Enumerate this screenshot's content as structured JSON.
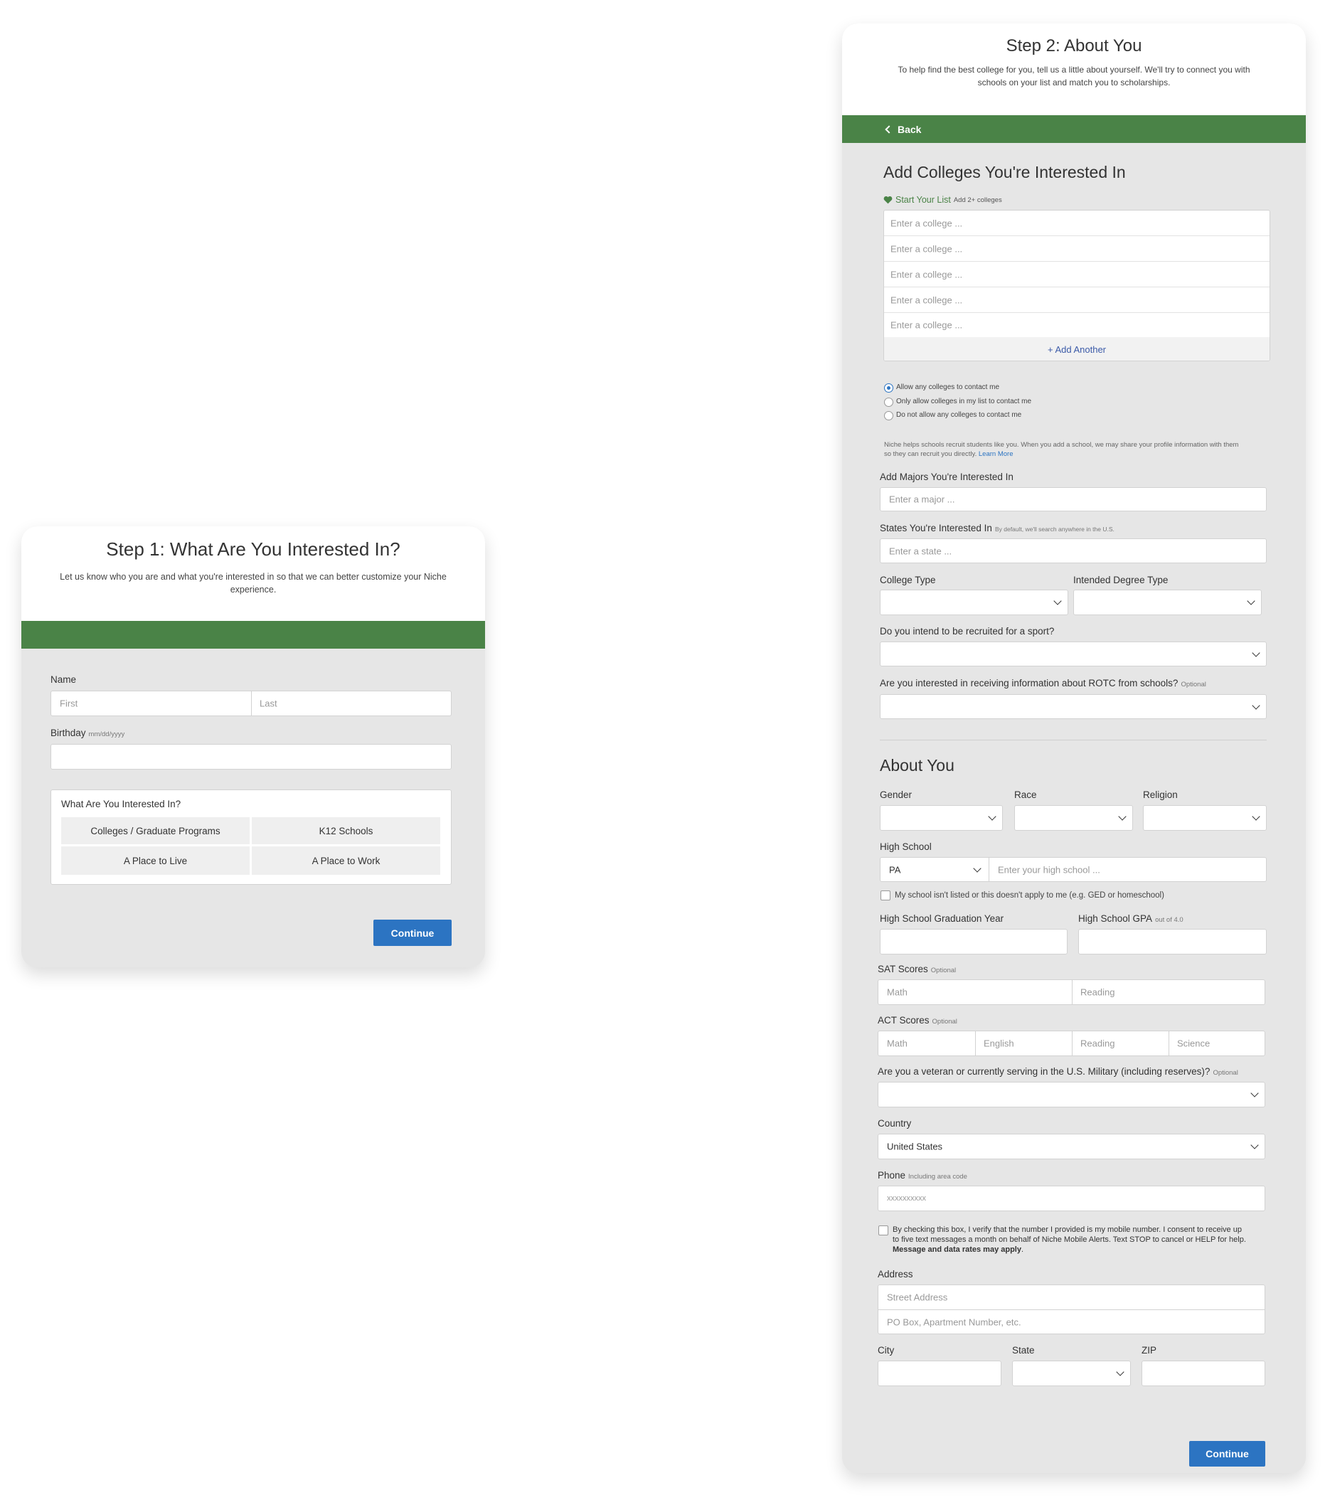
{
  "step1": {
    "title": "Step 1: What Are You Interested In?",
    "subtitle_line1": "Let us know who you are and what you're interested in so that we can better customize your Niche",
    "subtitle_line2": "experience.",
    "name_label": "Name",
    "first_placeholder": "First",
    "last_placeholder": "Last",
    "birthday_label": "Birthday",
    "birthday_hint": "mm/dd/yyyy",
    "interest_title": "What Are You Interested In?",
    "interests": [
      "Colleges / Graduate Programs",
      "K12 Schools",
      "A Place to Live",
      "A Place to Work"
    ],
    "continue": "Continue"
  },
  "step2": {
    "title": "Step 2: About You",
    "subtitle_line1": "To help find the best college for you, tell us a little about yourself. We'll try to connect you with",
    "subtitle_line2": "schools on your list and match you to scholarships.",
    "back": "Back",
    "colleges_heading": "Add Colleges You're Interested In",
    "start_list": "Start Your List",
    "start_list_hint": "Add 2+ colleges",
    "college_placeholder": "Enter a college ...",
    "add_another": "+ Add Another",
    "contact_options": [
      "Allow any colleges to contact me",
      "Only allow colleges in my list to contact me",
      "Do not allow any colleges to contact me"
    ],
    "recruit_note_line1": "Niche helps schools recruit students like you. When you add a school, we may share your profile information with them",
    "recruit_note_line2": "so they can recruit you directly.",
    "learn_more": "Learn More",
    "majors_label": "Add Majors You're Interested In",
    "major_placeholder": "Enter a major ...",
    "states_label": "States You're Interested In",
    "states_hint": "By default, we'll search anywhere in the U.S.",
    "state_placeholder": "Enter a state ...",
    "college_type_label": "College Type",
    "degree_type_label": "Intended Degree Type",
    "sport_label": "Do you intend to be recruited for a sport?",
    "rotc_label": "Are you interested in receiving information about ROTC from schools?",
    "optional": "Optional",
    "about_heading": "About You",
    "gender_label": "Gender",
    "race_label": "Race",
    "religion_label": "Religion",
    "high_school_label": "High School",
    "high_school_state": "PA",
    "high_school_placeholder": "Enter your high school ...",
    "not_listed": "My school isn't listed or this doesn't apply to me (e.g. GED or homeschool)",
    "grad_year_label": "High School Graduation Year",
    "gpa_label": "High School GPA",
    "gpa_hint": "out of 4.0",
    "sat_label": "SAT Scores",
    "sat_fields": [
      "Math",
      "Reading"
    ],
    "act_label": "ACT Scores",
    "act_fields": [
      "Math",
      "English",
      "Reading",
      "Science"
    ],
    "veteran_label": "Are you a veteran or currently serving in the U.S. Military (including reserves)?",
    "country_label": "Country",
    "country_value": "United States",
    "phone_label": "Phone",
    "phone_hint": "Including area code",
    "phone_placeholder": "xxxxxxxxxx",
    "consent_line1": "By checking this box, I verify that the number I provided is my mobile number. I consent to receive up",
    "consent_line2": "to five text messages a month on behalf of Niche Mobile Alerts. Text STOP to cancel or HELP for help.",
    "consent_bold": "Message and data rates may apply",
    "address_label": "Address",
    "street_placeholder": "Street Address",
    "po_placeholder": "PO Box, Apartment Number, etc.",
    "city_label": "City",
    "state_label": "State",
    "zip_label": "ZIP",
    "continue": "Continue"
  },
  "colors": {
    "green": "#4a8347",
    "blue": "#2c74c2",
    "card_bg": "#e6e6e6"
  }
}
